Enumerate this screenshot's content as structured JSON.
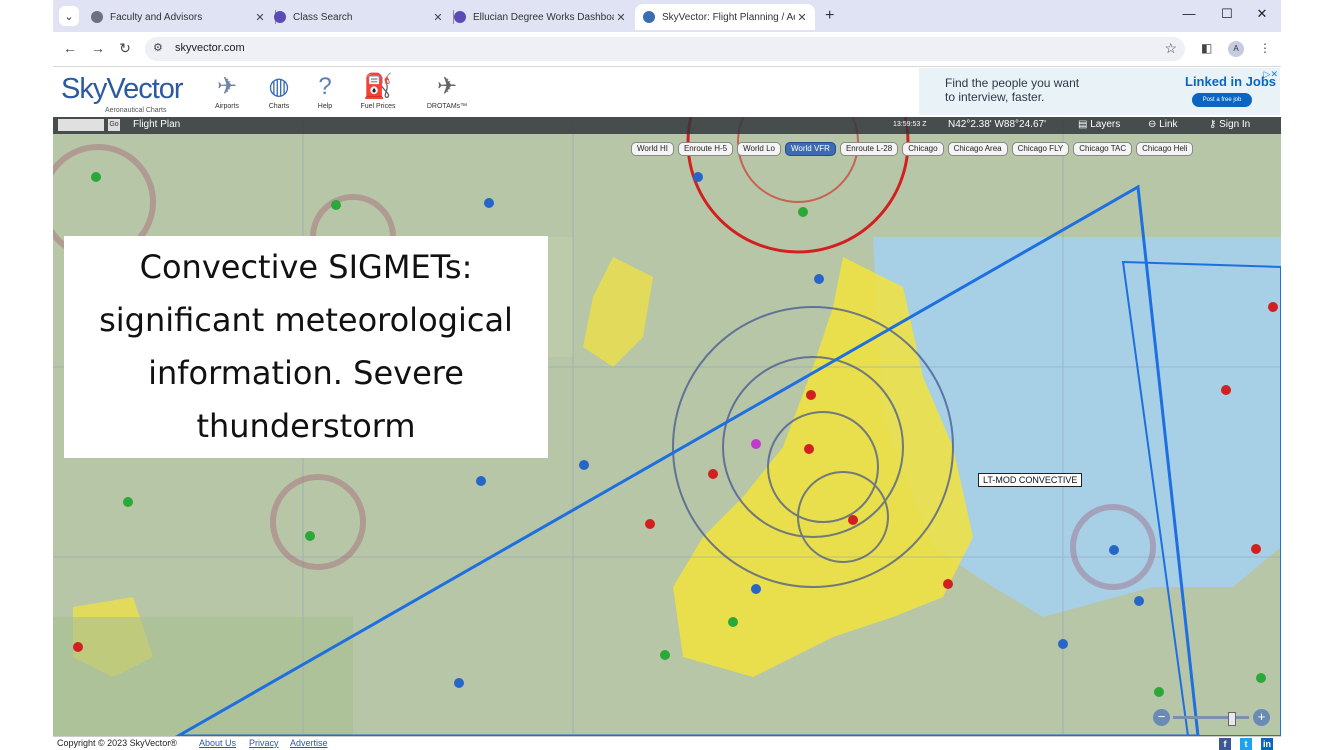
{
  "browser": {
    "tabs": [
      {
        "title": "Faculty and Advisors",
        "active": false
      },
      {
        "title": "Class Search",
        "active": false
      },
      {
        "title": "Ellucian Degree Works Dashboard",
        "active": false
      },
      {
        "title": "SkyVector: Flight Planning / Aer",
        "active": true
      }
    ],
    "address": "skyvector.com",
    "profile_initial": "A"
  },
  "header": {
    "logo": "SkyVector",
    "tagline": "Aeronautical Charts",
    "nav": [
      {
        "label": "Airports",
        "icon": "airplane-icon"
      },
      {
        "label": "Charts",
        "icon": "globe-icon"
      },
      {
        "label": "Help",
        "icon": "help-bubble-icon"
      },
      {
        "label": "Fuel Prices",
        "icon": "fuel-price-sign-icon"
      },
      {
        "label": "DROTAMs™",
        "icon": "drone-icon"
      }
    ],
    "ad": {
      "line1": "Find the people you want",
      "line2": "to interview, faster.",
      "brand": "Linked in Jobs",
      "cta": "Post a free job"
    }
  },
  "mapbar": {
    "flight_plan": "Flight Plan",
    "go": "Go",
    "time": "13:59:53 Z",
    "coords": "N42°2.38' W88°24.67'",
    "layers": "Layers",
    "link": "Link",
    "sign_in": "Sign In"
  },
  "chart_buttons": [
    {
      "label": "World HI",
      "selected": false
    },
    {
      "label": "Enroute H-5",
      "selected": false
    },
    {
      "label": "World Lo",
      "selected": false
    },
    {
      "label": "World VFR",
      "selected": true
    },
    {
      "label": "Enroute L-28",
      "selected": false
    },
    {
      "label": "Chicago",
      "selected": false
    },
    {
      "label": "Chicago Area",
      "selected": false
    },
    {
      "label": "Chicago FLY",
      "selected": false
    },
    {
      "label": "Chicago TAC",
      "selected": false
    },
    {
      "label": "Chicago Heli",
      "selected": false
    }
  ],
  "map": {
    "sigmet_label": "LT-MOD CONVECTIVE",
    "colors": {
      "sigmet_line": "#1e6fe0",
      "urban": "#f2e23c",
      "water": "#a7cfe6",
      "airspace_red": "#d22020"
    }
  },
  "callout": {
    "text": "Convective SIGMETs: significant meteorological information. Severe thunderstorm"
  },
  "footer": {
    "copyright": "Copyright © 2023 SkyVector®",
    "about": "About Us",
    "privacy": "Privacy",
    "advertise": "Advertise"
  }
}
